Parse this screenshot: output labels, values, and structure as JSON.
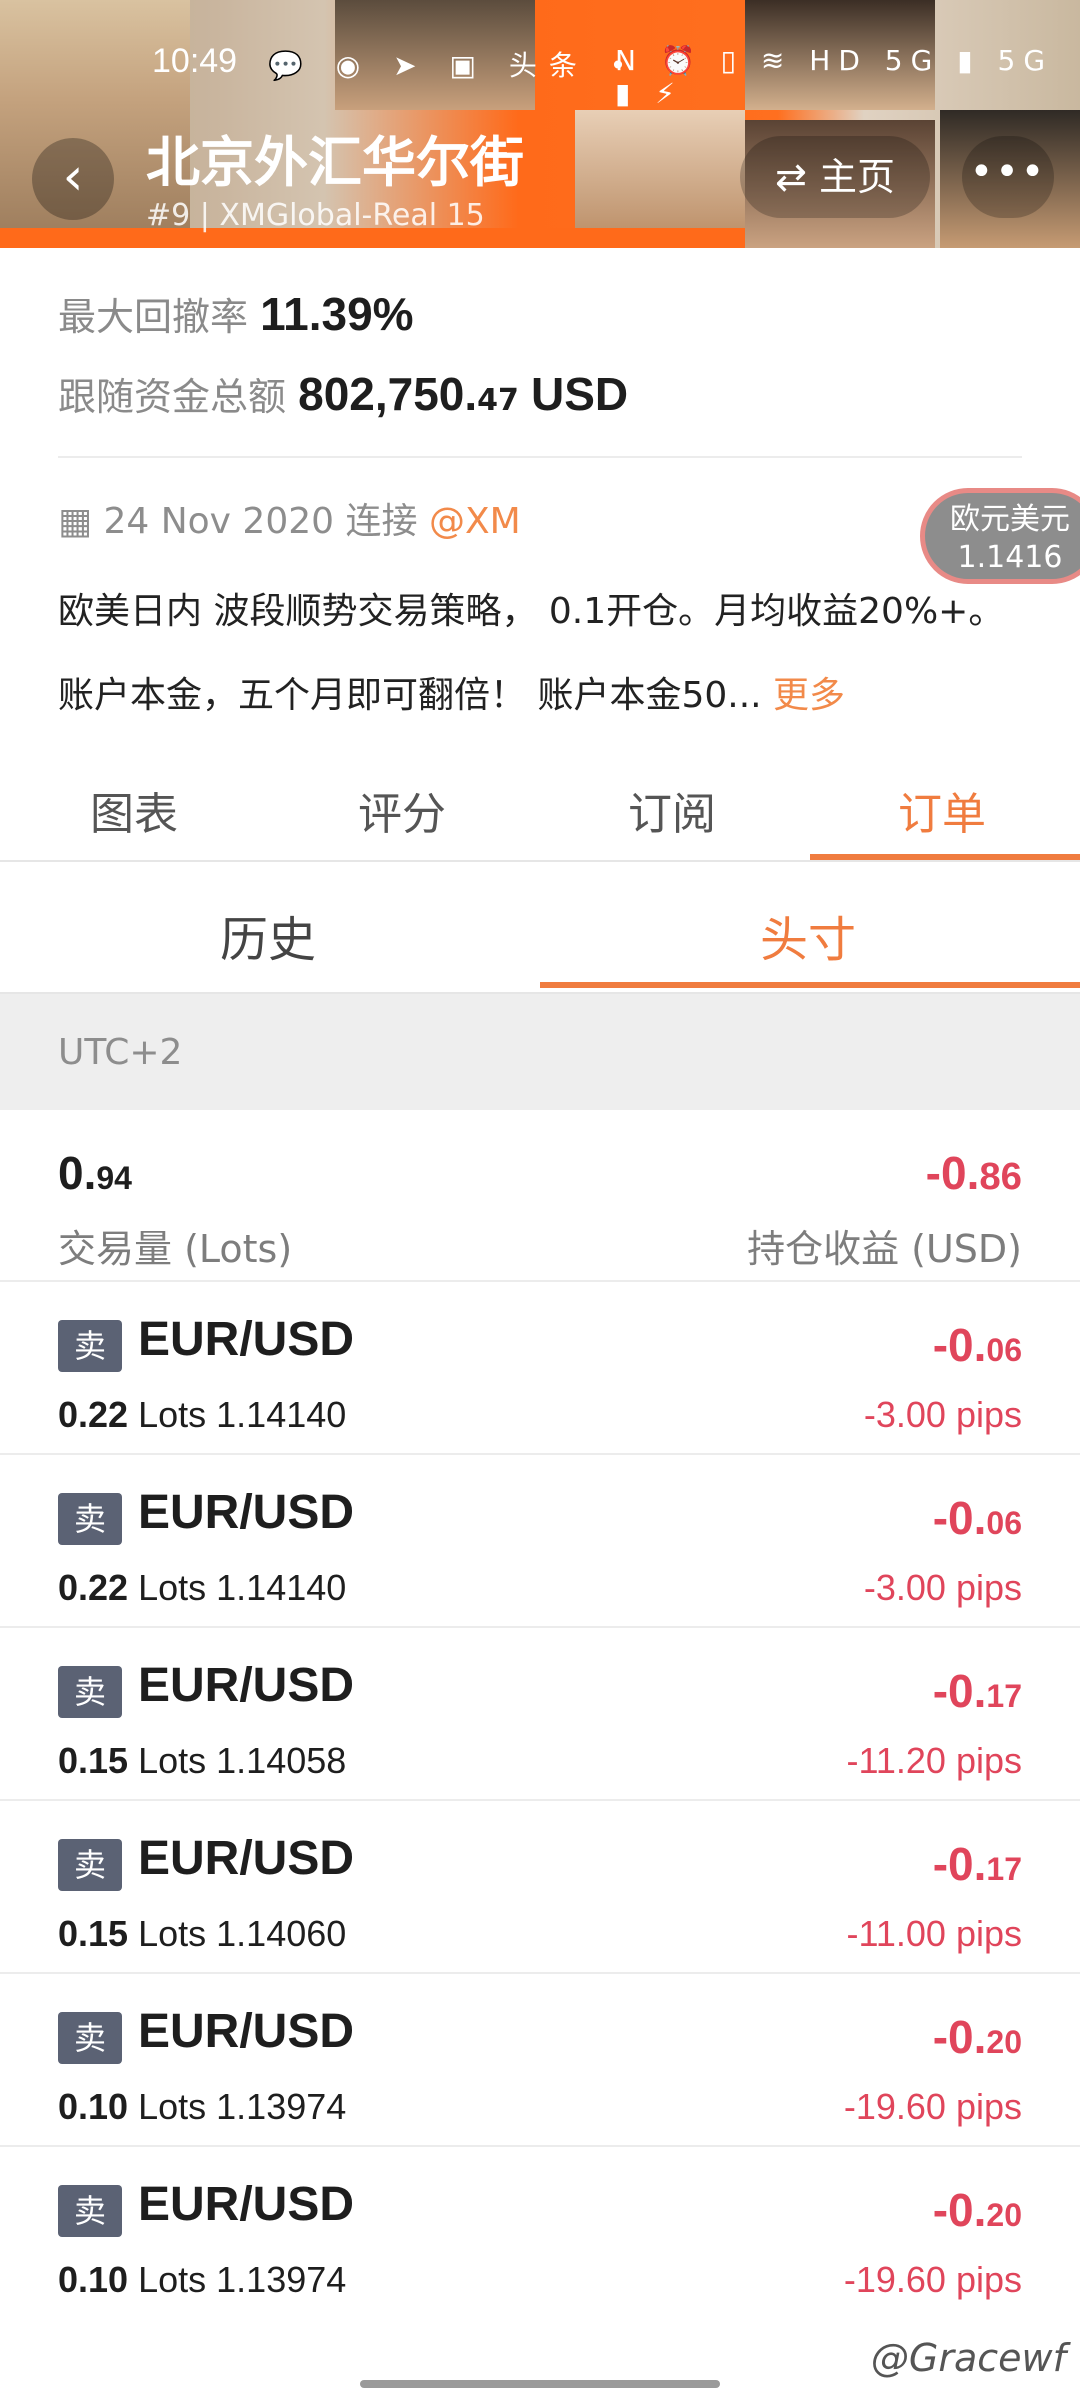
{
  "status_bar": {
    "time": "10:49",
    "icons_left": "💬 ◉ ➤ ▣ 头条 •",
    "icons_right": "N ⏰ ▯ ≋ HD 5G ▮ 5G ▮ ⚡"
  },
  "header": {
    "title": "北京外汇华尔街",
    "subtitle": "#9 | XMGlobal-Real 15",
    "home_label": "⇄ 主页",
    "more_label": "•••"
  },
  "stats": {
    "max_drawdown_label": "最大回撤率",
    "max_drawdown_value": "11.39%",
    "total_funds_label": "跟随资金总额",
    "total_funds_main": "802,750.",
    "total_funds_decimal": "47",
    "total_funds_currency": "USD"
  },
  "info": {
    "date_text": "24 Nov 2020 连接",
    "broker": "@XM",
    "description": "欧美日内 波段顺势交易策略， 0.1开仓。月均收益20%+。 账户本金，五个月即可翻倍！ 账户本金50...",
    "more_label": "更多"
  },
  "floating_chip": {
    "name": "欧元美元",
    "price": "1.1416"
  },
  "tabs": [
    "图表",
    "评分",
    "订阅",
    "订单"
  ],
  "subtabs": [
    "历史",
    "头寸"
  ],
  "timezone": "UTC+2",
  "summary": {
    "volume_int": "0.",
    "volume_dec": "94",
    "volume_label": "交易量 (Lots)",
    "pl_int": "-0.",
    "pl_dec": "86",
    "pl_label": "持仓收益 (USD)"
  },
  "orders": [
    {
      "side": "卖",
      "symbol": "EUR/USD",
      "lots": "0.22",
      "lots_unit": "Lots",
      "price": "1.14140",
      "pl_int": "-0.",
      "pl_dec": "06",
      "pips": "-3.00 pips"
    },
    {
      "side": "卖",
      "symbol": "EUR/USD",
      "lots": "0.22",
      "lots_unit": "Lots",
      "price": "1.14140",
      "pl_int": "-0.",
      "pl_dec": "06",
      "pips": "-3.00 pips"
    },
    {
      "side": "卖",
      "symbol": "EUR/USD",
      "lots": "0.15",
      "lots_unit": "Lots",
      "price": "1.14058",
      "pl_int": "-0.",
      "pl_dec": "17",
      "pips": "-11.20 pips"
    },
    {
      "side": "卖",
      "symbol": "EUR/USD",
      "lots": "0.15",
      "lots_unit": "Lots",
      "price": "1.14060",
      "pl_int": "-0.",
      "pl_dec": "17",
      "pips": "-11.00 pips"
    },
    {
      "side": "卖",
      "symbol": "EUR/USD",
      "lots": "0.10",
      "lots_unit": "Lots",
      "price": "1.13974",
      "pl_int": "-0.",
      "pl_dec": "20",
      "pips": "-19.60 pips"
    },
    {
      "side": "卖",
      "symbol": "EUR/USD",
      "lots": "0.10",
      "lots_unit": "Lots",
      "price": "1.13974",
      "pl_int": "-0.",
      "pl_dec": "20",
      "pips": "-19.60 pips"
    }
  ],
  "watermark": "@Gracewf"
}
